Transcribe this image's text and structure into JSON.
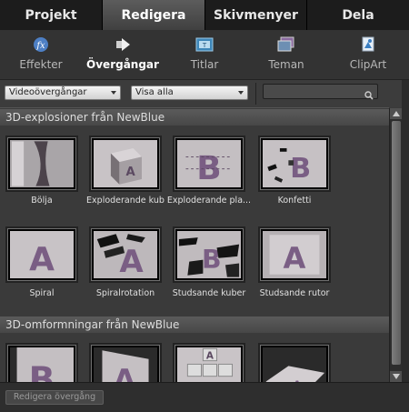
{
  "tabs": [
    {
      "label": "Projekt",
      "active": false
    },
    {
      "label": "Redigera",
      "active": true
    },
    {
      "label": "Skivmenyer",
      "active": false
    },
    {
      "label": "Dela",
      "active": false
    }
  ],
  "toolbar": {
    "items": [
      {
        "label": "Effekter",
        "icon": "fx-icon",
        "active": false
      },
      {
        "label": "Övergångar",
        "icon": "transition-arrow-icon",
        "active": true
      },
      {
        "label": "Titlar",
        "icon": "title-film-icon",
        "active": false
      },
      {
        "label": "Teman",
        "icon": "theme-icon",
        "active": false
      },
      {
        "label": "ClipArt",
        "icon": "clipart-icon",
        "active": false
      }
    ]
  },
  "filters": {
    "category": "Videoövergångar",
    "view": "Visa alla",
    "search_value": "",
    "search_icon": "magnifier-icon"
  },
  "sections": [
    {
      "title": "3D-explosioner från NewBlue",
      "items": [
        {
          "label": "Bölja",
          "glyph": ""
        },
        {
          "label": "Exploderande kub",
          "glyph": "A"
        },
        {
          "label": "Exploderande pla...",
          "glyph": "B"
        },
        {
          "label": "Konfetti",
          "glyph": "B"
        },
        {
          "label": "Spiral",
          "glyph": "A"
        },
        {
          "label": "Spiralrotation",
          "glyph": "A"
        },
        {
          "label": "Studsande kuber",
          "glyph": "B"
        },
        {
          "label": "Studsande rutor",
          "glyph": "A"
        }
      ]
    },
    {
      "title": "3D-omformningar från NewBlue",
      "items": [
        {
          "label": "",
          "glyph": "B"
        },
        {
          "label": "",
          "glyph": "A"
        },
        {
          "label": "",
          "glyph": "A"
        },
        {
          "label": "",
          "glyph": "A"
        }
      ]
    }
  ],
  "footer": {
    "edit_button": "Redigera övergång"
  },
  "colors": {
    "accent_purple": "#6b4a73",
    "thumb_border": "#6e6e6e"
  }
}
